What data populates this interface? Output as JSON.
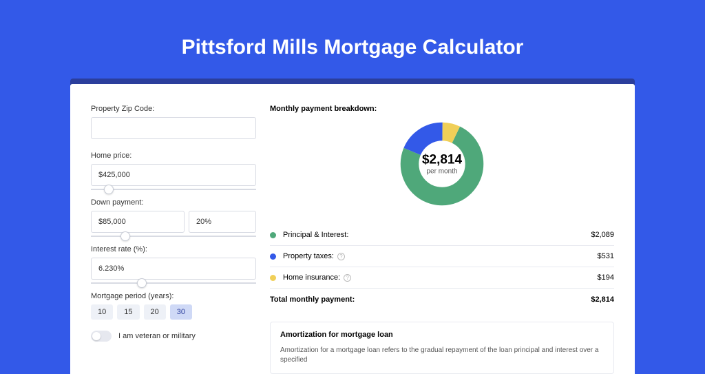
{
  "title": "Pittsford Mills Mortgage Calculator",
  "form": {
    "zip_label": "Property Zip Code:",
    "zip_value": "",
    "home_price_label": "Home price:",
    "home_price_value": "$425,000",
    "down_payment_label": "Down payment:",
    "down_payment_amount": "$85,000",
    "down_payment_pct": "20%",
    "interest_label": "Interest rate (%):",
    "interest_value": "6.230%",
    "period_label": "Mortgage period (years):",
    "period_options": [
      "10",
      "15",
      "20",
      "30"
    ],
    "period_selected": "30",
    "veteran_label": "I am veteran or military"
  },
  "breakdown": {
    "title": "Monthly payment breakdown:",
    "center_amount": "$2,814",
    "center_sub": "per month",
    "rows": [
      {
        "label": "Principal & Interest:",
        "value": "$2,089",
        "color": "#4fa87a",
        "info": false
      },
      {
        "label": "Property taxes:",
        "value": "$531",
        "color": "#3359e8",
        "info": true
      },
      {
        "label": "Home insurance:",
        "value": "$194",
        "color": "#f0cf58",
        "info": true
      }
    ],
    "total_label": "Total monthly payment:",
    "total_value": "$2,814"
  },
  "amort": {
    "title": "Amortization for mortgage loan",
    "body": "Amortization for a mortgage loan refers to the gradual repayment of the loan principal and interest over a specified"
  },
  "chart_data": {
    "type": "pie",
    "title": "Monthly payment breakdown",
    "series": [
      {
        "name": "Principal & Interest",
        "value": 2089,
        "color": "#4fa87a"
      },
      {
        "name": "Property taxes",
        "value": 531,
        "color": "#3359e8"
      },
      {
        "name": "Home insurance",
        "value": 194,
        "color": "#f0cf58"
      }
    ],
    "total": 2814,
    "center_label": "$2,814 per month"
  }
}
